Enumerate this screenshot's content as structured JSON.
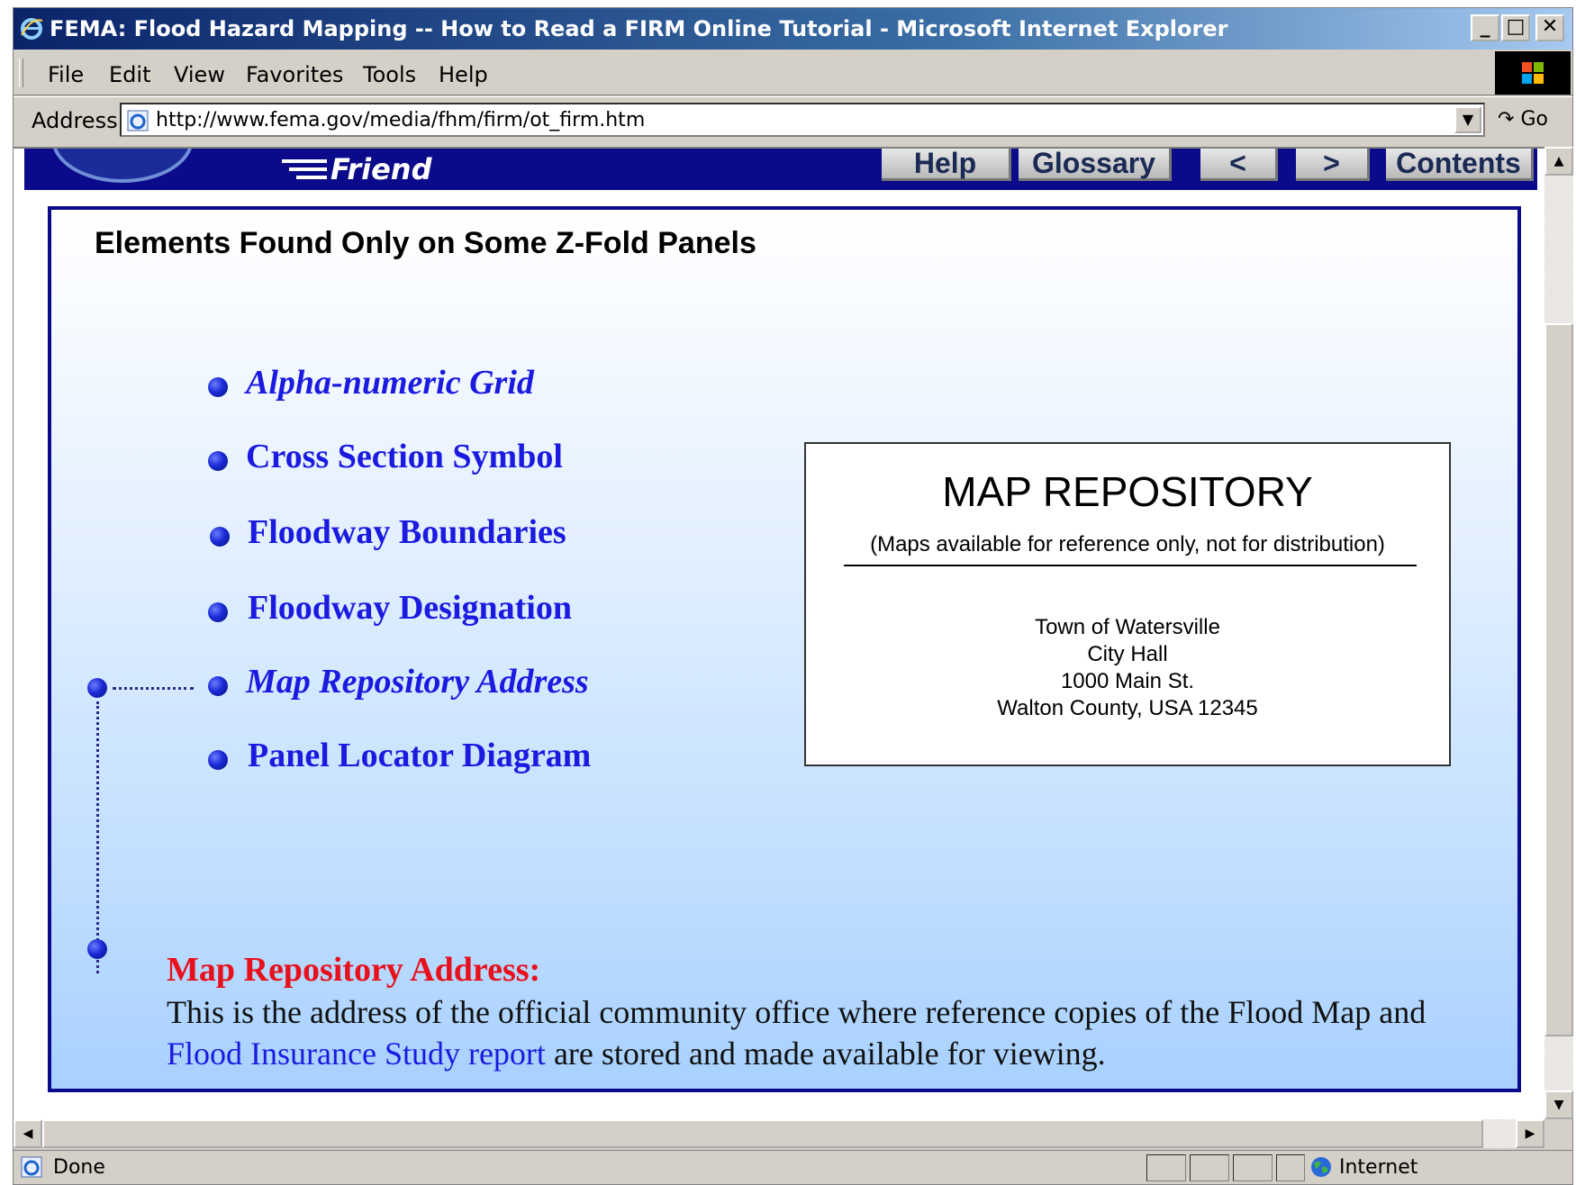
{
  "window": {
    "title": "FEMA: Flood Hazard Mapping -- How to Read a FIRM Online Tutorial - Microsoft Internet Explorer",
    "controls": {
      "minimize": "_",
      "maximize": "□",
      "close": "✕"
    }
  },
  "menu": [
    "File",
    "Edit",
    "View",
    "Favorites",
    "Tools",
    "Help"
  ],
  "address_bar": {
    "label": "Address",
    "url": "http://www.fema.gov/media/fhm/firm/ot_firm.htm",
    "go_label": "Go"
  },
  "banner": {
    "brand_text": "Friend",
    "nav_buttons": [
      "Help",
      "Glossary",
      "<",
      ">",
      "Contents"
    ]
  },
  "page": {
    "heading": "Elements Found Only on Some Z-Fold Panels",
    "links": [
      {
        "label": "Alpha-numeric Grid",
        "italic": true
      },
      {
        "label": "Cross Section Symbol",
        "italic": false
      },
      {
        "label": "Floodway Boundaries",
        "italic": false
      },
      {
        "label": "Floodway Designation",
        "italic": false
      },
      {
        "label": "Map Repository Address",
        "italic": true
      },
      {
        "label": "Panel Locator Diagram",
        "italic": false
      }
    ],
    "repository_card": {
      "title": "MAP REPOSITORY",
      "subtitle": "(Maps available for reference only, not for distribution)",
      "address_lines": [
        "Town of Watersville",
        "City Hall",
        "1000 Main St.",
        "Walton County, USA 12345"
      ]
    },
    "description": {
      "title": "Map Repository Address:",
      "text_part1": "This is the address of the official community office where reference copies of the Flood Map and ",
      "link_text": "Flood Insurance Study report",
      "text_part2": " are stored and made available for viewing."
    }
  },
  "status_bar": {
    "status": "Done",
    "zone": "Internet"
  },
  "colors": {
    "title_bar": "#0a246a",
    "banner": "#0a0a8a",
    "link": "#1a1ae0",
    "description_title": "#e8101a"
  }
}
